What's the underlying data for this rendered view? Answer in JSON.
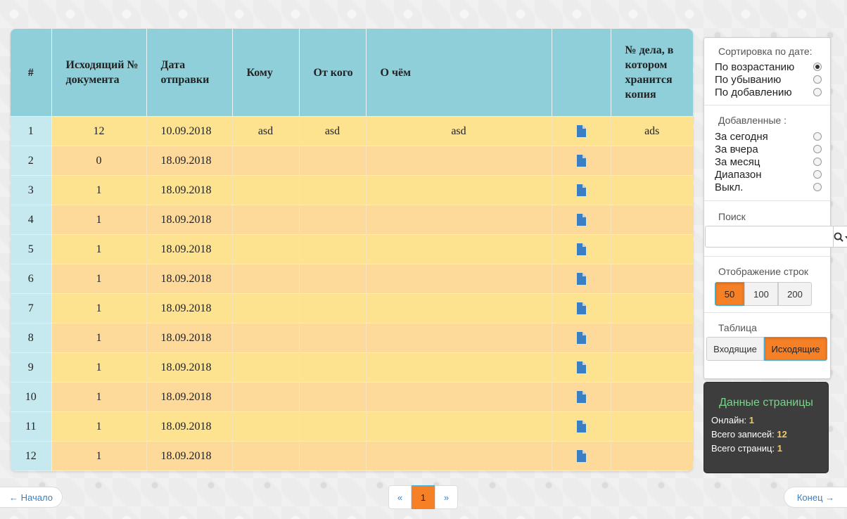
{
  "table": {
    "headers": {
      "num": "#",
      "doc_number": "Исходящий № документа",
      "send_date": "Дата отправки",
      "to": "Кому",
      "from": "От кого",
      "about": "О чём",
      "file": "",
      "case": "№ дела, в котором хранится копия"
    },
    "rows": [
      {
        "num": "1",
        "doc_number": "12",
        "send_date": "10.09.2018",
        "to": "asd",
        "from": "asd",
        "about": "asd",
        "case": "ads"
      },
      {
        "num": "2",
        "doc_number": "0",
        "send_date": "18.09.2018",
        "to": "",
        "from": "",
        "about": "",
        "case": ""
      },
      {
        "num": "3",
        "doc_number": "1",
        "send_date": "18.09.2018",
        "to": "",
        "from": "",
        "about": "",
        "case": ""
      },
      {
        "num": "4",
        "doc_number": "1",
        "send_date": "18.09.2018",
        "to": "",
        "from": "",
        "about": "",
        "case": ""
      },
      {
        "num": "5",
        "doc_number": "1",
        "send_date": "18.09.2018",
        "to": "",
        "from": "",
        "about": "",
        "case": ""
      },
      {
        "num": "6",
        "doc_number": "1",
        "send_date": "18.09.2018",
        "to": "",
        "from": "",
        "about": "",
        "case": ""
      },
      {
        "num": "7",
        "doc_number": "1",
        "send_date": "18.09.2018",
        "to": "",
        "from": "",
        "about": "",
        "case": ""
      },
      {
        "num": "8",
        "doc_number": "1",
        "send_date": "18.09.2018",
        "to": "",
        "from": "",
        "about": "",
        "case": ""
      },
      {
        "num": "9",
        "doc_number": "1",
        "send_date": "18.09.2018",
        "to": "",
        "from": "",
        "about": "",
        "case": ""
      },
      {
        "num": "10",
        "doc_number": "1",
        "send_date": "18.09.2018",
        "to": "",
        "from": "",
        "about": "",
        "case": ""
      },
      {
        "num": "11",
        "doc_number": "1",
        "send_date": "18.09.2018",
        "to": "",
        "from": "",
        "about": "",
        "case": ""
      },
      {
        "num": "12",
        "doc_number": "1",
        "send_date": "18.09.2018",
        "to": "",
        "from": "",
        "about": "",
        "case": ""
      }
    ],
    "file_icon": "document-icon"
  },
  "sidebar": {
    "sort": {
      "title": "Сортировка по дате:",
      "options": [
        "По возрастанию",
        "По убыванию",
        "По добавлению"
      ],
      "selected": 0
    },
    "added": {
      "title": "Добавленные :",
      "options": [
        "За сегодня",
        "За вчера",
        "За месяц",
        "Диапазон",
        "Выкл."
      ]
    },
    "search": {
      "title": "Поиск",
      "value": "",
      "icon": "search-icon"
    },
    "rows_display": {
      "title": "Отображение строк",
      "options": [
        "50",
        "100",
        "200"
      ],
      "selected": "50"
    },
    "table_type": {
      "title": "Таблица",
      "options": [
        "Входящие",
        "Исходящие"
      ],
      "selected": "Исходящие"
    }
  },
  "info": {
    "title": "Данные страницы",
    "online_label": "Онлайн:",
    "online": "1",
    "records_label": "Всего записей:",
    "records": "12",
    "pages_label": "Всего страниц:",
    "pages": "1"
  },
  "pagination": {
    "first": "← Начало",
    "last": "Конец →",
    "prev": "«",
    "next": "»",
    "current": "1"
  },
  "colors": {
    "header": "#8ecfd9",
    "row_odd": "#fde390",
    "row_even": "#fdd99a",
    "num_col": "#c6e9ef",
    "accent": "#f58025",
    "icon_blue": "#3a7fc4"
  }
}
